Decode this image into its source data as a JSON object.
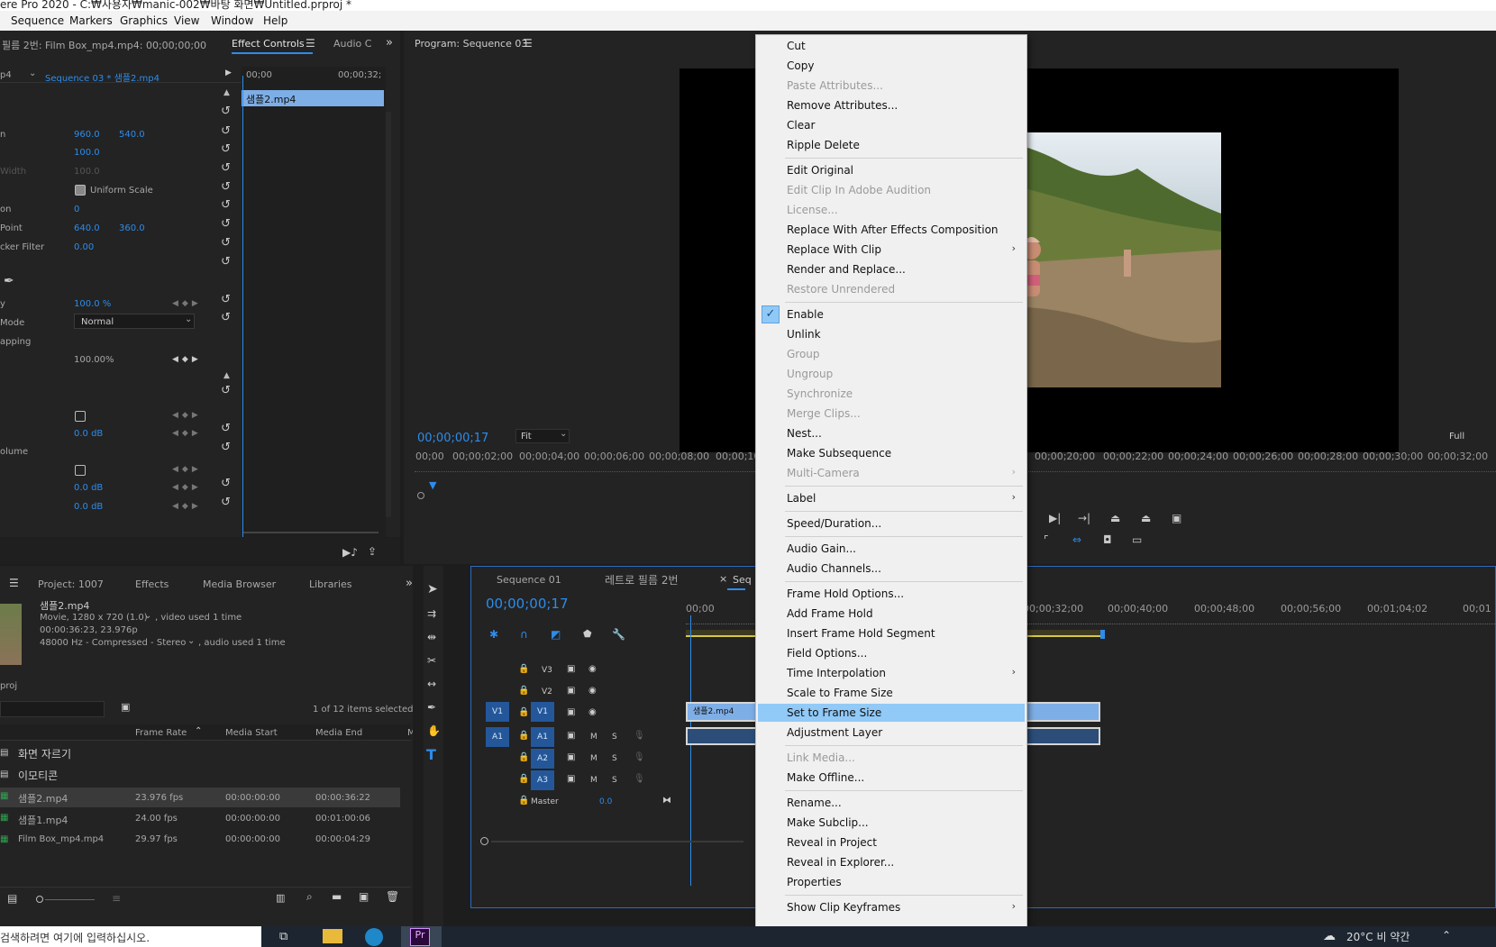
{
  "app": {
    "title": "ere Pro 2020 - C:₩사용자₩manic-002₩바탕 화면₩Untitled.prproj *",
    "menu": [
      "Sequence",
      "Markers",
      "Graphics",
      "View",
      "Window",
      "Help"
    ]
  },
  "effect_controls": {
    "source_tab": "필름 2번: Film Box_mp4.mp4: 00;00;00;00",
    "active_tab": "Effect Controls",
    "audio_tab": "Audio C",
    "clip_prefix": "p4",
    "sequence_label": "Sequence 03 * 샘플2.mp4",
    "ruler_start": "00;00",
    "ruler_end": "00;00;32;",
    "clip_bar_name": "샘플2.mp4",
    "rows": {
      "position_label": "n",
      "position_x": "960.0",
      "position_y": "540.0",
      "scale_value": "100.0",
      "width_label": "Width",
      "width_value": "100.0",
      "uniform_scale": "Uniform Scale",
      "rotation_label": "on",
      "rotation_value": "0",
      "anchor_label": "Point",
      "anchor_x": "640.0",
      "anchor_y": "360.0",
      "flicker_label": "cker Filter",
      "flicker_value": "0.00",
      "opacity_value": "100.0 %",
      "mode_label": "Mode",
      "mode_value": "Normal",
      "remap_label": "apping",
      "speed_value": "100.00%",
      "volume_db": "0.0 dB",
      "chan_volume_label": "olume",
      "left_db": "0.0 dB",
      "right_db": "0.0 dB"
    }
  },
  "program": {
    "title": "Program: Sequence 03",
    "timecode": "00;00;00;17",
    "fit": "Fit",
    "full": "Full",
    "ruler_left": [
      "00;00",
      "00;00;02;00",
      "00;00;04;00",
      "00;00;06;00",
      "00;00;08;00",
      "00;00;10"
    ],
    "ruler_right": [
      "00;00;20;00",
      "00;00;22;00",
      "00;00;24;00",
      "00;00;26;00",
      "00;00;28;00",
      "00;00;30;00",
      "00;00;32;00"
    ]
  },
  "project": {
    "tabs": [
      "Project: 1007",
      "Effects",
      "Media Browser",
      "Libraries"
    ],
    "clip_name": "샘플2.mp4",
    "clip_info1": "Movie, 1280 x 720 (1.0)",
    "clip_info1b": ", video used 1 time",
    "clip_info2": "00:00:36:23, 23.976p",
    "clip_info3": "48000 Hz - Compressed - Stereo",
    "clip_info3b": ", audio used 1 time",
    "proj_label": "proj",
    "selected_count": "1 of 12 items selected",
    "columns": [
      "Frame Rate",
      "Media Start",
      "Media End",
      "M"
    ],
    "bins": [
      "화면 자르기",
      "이모티콘"
    ],
    "items": [
      {
        "name": "샘플2.mp4",
        "rate": "23.976 fps",
        "start": "00:00:00:00",
        "end": "00:00:36:22"
      },
      {
        "name": "샘플1.mp4",
        "rate": "24.00 fps",
        "start": "00:00:00:00",
        "end": "00:01:00:06"
      },
      {
        "name": "Film Box_mp4.mp4",
        "rate": "29.97 fps",
        "start": "00:00:00:00",
        "end": "00:00:04:29"
      }
    ]
  },
  "timeline": {
    "tabs": [
      "Sequence 01",
      "레트로 필름 2번",
      "Seq"
    ],
    "timecode": "00;00;00;17",
    "ruler": [
      "00;00",
      "00;00;32;00",
      "00;00;40;00",
      "00;00;48;00",
      "00;00;56;00",
      "00;01;04;02",
      "00;01"
    ],
    "tracks": {
      "v3": "V3",
      "v2": "V2",
      "v1": "V1",
      "a1": "A1",
      "a2": "A2",
      "a3": "A3",
      "master": "Master",
      "master_value": "0.0",
      "m": "M",
      "s": "S"
    },
    "clip_name": "샘플2.mp4"
  },
  "context_menu": {
    "items": [
      {
        "label": "Cut",
        "enabled": true
      },
      {
        "label": "Copy",
        "enabled": true
      },
      {
        "label": "Paste Attributes...",
        "enabled": false
      },
      {
        "label": "Remove Attributes...",
        "enabled": true
      },
      {
        "label": "Clear",
        "enabled": true
      },
      {
        "label": "Ripple Delete",
        "enabled": true
      },
      {
        "label": "Edit Original",
        "enabled": true
      },
      {
        "label": "Edit Clip In Adobe Audition",
        "enabled": false
      },
      {
        "label": "License...",
        "enabled": false
      },
      {
        "label": "Replace With After Effects Composition",
        "enabled": true
      },
      {
        "label": "Replace With Clip",
        "enabled": true,
        "submenu": true
      },
      {
        "label": "Render and Replace...",
        "enabled": true
      },
      {
        "label": "Restore Unrendered",
        "enabled": false
      },
      {
        "label": "Enable",
        "enabled": true,
        "checked": true
      },
      {
        "label": "Unlink",
        "enabled": true
      },
      {
        "label": "Group",
        "enabled": false
      },
      {
        "label": "Ungroup",
        "enabled": false
      },
      {
        "label": "Synchronize",
        "enabled": false
      },
      {
        "label": "Merge Clips...",
        "enabled": false
      },
      {
        "label": "Nest...",
        "enabled": true
      },
      {
        "label": "Make Subsequence",
        "enabled": true
      },
      {
        "label": "Multi-Camera",
        "enabled": false,
        "submenu": true
      },
      {
        "label": "Label",
        "enabled": true,
        "submenu": true
      },
      {
        "label": "Speed/Duration...",
        "enabled": true
      },
      {
        "label": "Audio Gain...",
        "enabled": true
      },
      {
        "label": "Audio Channels...",
        "enabled": true
      },
      {
        "label": "Frame Hold Options...",
        "enabled": true
      },
      {
        "label": "Add Frame Hold",
        "enabled": true
      },
      {
        "label": "Insert Frame Hold Segment",
        "enabled": true
      },
      {
        "label": "Field Options...",
        "enabled": true
      },
      {
        "label": "Time Interpolation",
        "enabled": true,
        "submenu": true
      },
      {
        "label": "Scale to Frame Size",
        "enabled": true
      },
      {
        "label": "Set to Frame Size",
        "enabled": true,
        "highlighted": true
      },
      {
        "label": "Adjustment Layer",
        "enabled": true
      },
      {
        "label": "Link Media...",
        "enabled": false
      },
      {
        "label": "Make Offline...",
        "enabled": true
      },
      {
        "label": "Rename...",
        "enabled": true
      },
      {
        "label": "Make Subclip...",
        "enabled": true
      },
      {
        "label": "Reveal in Project",
        "enabled": true
      },
      {
        "label": "Reveal in Explorer...",
        "enabled": true
      },
      {
        "label": "Properties",
        "enabled": true
      },
      {
        "label": "Show Clip Keyframes",
        "enabled": true,
        "submenu": true
      }
    ]
  },
  "taskbar": {
    "search_placeholder": "검색하려면 여기에 입력하십시오.",
    "weather": "20°C 비 약간"
  },
  "colors": {
    "accent": "#2d8ceb",
    "menu_highlight": "#91c9f7",
    "clip_blue": "#7eaee6",
    "work_area_yellow": "#d6c84a"
  }
}
